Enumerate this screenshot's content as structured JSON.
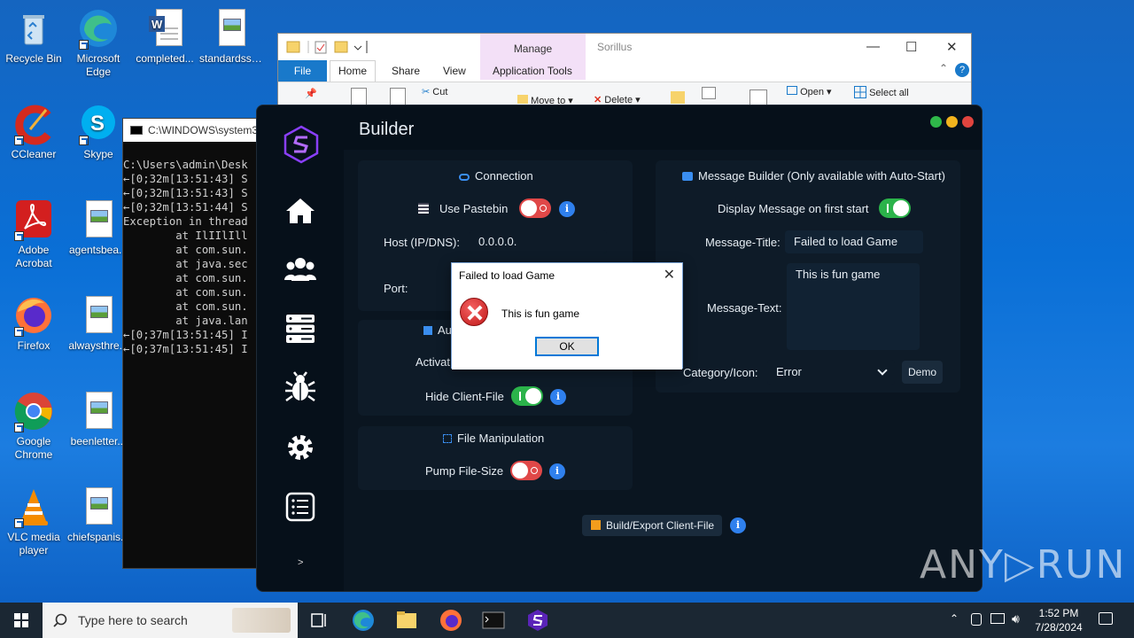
{
  "desktop": {
    "icons": [
      {
        "label": "Recycle Bin"
      },
      {
        "label": "Microsoft Edge"
      },
      {
        "label": "completed..."
      },
      {
        "label": "standardsst..."
      },
      {
        "label": "CCleaner"
      },
      {
        "label": "Skype"
      },
      {
        "label": "Adobe Acrobat"
      },
      {
        "label": "agentsbea..."
      },
      {
        "label": "Firefox"
      },
      {
        "label": "alwaysthre..."
      },
      {
        "label": "Google Chrome"
      },
      {
        "label": "beenletter..."
      },
      {
        "label": "VLC media player"
      },
      {
        "label": "chiefspanis..."
      }
    ]
  },
  "explorer": {
    "title": "Sorillus",
    "manage_tab": "Manage",
    "tabs": [
      "File",
      "Home",
      "Share",
      "View",
      "Application Tools"
    ],
    "ribbon": {
      "cut": "Cut",
      "move_to": "Move to",
      "delete": "Delete",
      "open": "Open",
      "select_all": "Select all"
    }
  },
  "console": {
    "title": "C:\\WINDOWS\\system3",
    "lines": [
      "C:\\Users\\admin\\Desk",
      "←[0;32m[13:51:43] S",
      "←[0;32m[13:51:43] S",
      "←[0;32m[13:51:44] S",
      "Exception in thread",
      "        at IlIIlIll",
      "        at com.sun.",
      "        at java.sec",
      "        at com.sun.",
      "        at com.sun.",
      "        at com.sun.",
      "        at java.lan",
      "←[0;37m[13:51:45] I",
      "←[0;37m[13:51:45] I"
    ]
  },
  "builder": {
    "title": "Builder",
    "sidebar_more": ">",
    "connection": {
      "title": "Connection",
      "use_pastebin": "Use Pastebin",
      "host_label": "Host (IP/DNS):",
      "host_value": "0.0.0.0.",
      "port_label": "Port:"
    },
    "autostart": {
      "title_partial": "Au",
      "activate_partial": "Activat",
      "hide_client": "Hide Client-File"
    },
    "file_manipulation": {
      "title": "File Manipulation",
      "pump": "Pump File-Size"
    },
    "message_builder": {
      "title": "Message Builder (Only available with Auto-Start)",
      "display_first": "Display Message on first start",
      "title_label": "Message-Title:",
      "title_value": "Failed to load Game",
      "text_label": "Message-Text:",
      "text_value": "This is fun game",
      "category_label": "Category/Icon:",
      "category_value": "Error",
      "demo": "Demo"
    },
    "build_button": "Build/Export Client-File",
    "info_glyph": "i"
  },
  "msgbox": {
    "title": "Failed to load Game",
    "text": "This is fun game",
    "ok": "OK"
  },
  "watermark": "ANY▷RUN",
  "taskbar": {
    "search_placeholder": "Type here to search",
    "time": "1:52 PM",
    "date": "7/28/2024"
  },
  "colors": {
    "accent_blue": "#2f80ed",
    "toggle_on": "#2bb34a",
    "toggle_off": "#e04848",
    "logo_purple": "#8a3ffc"
  }
}
